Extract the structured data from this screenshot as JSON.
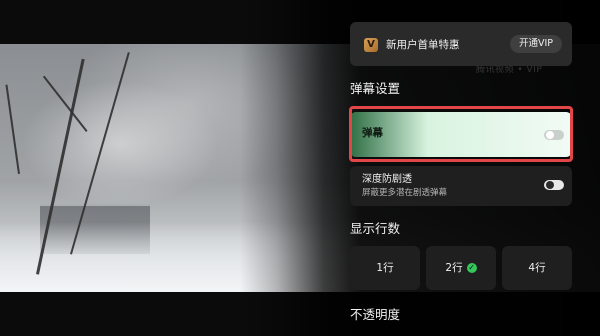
{
  "watermark": "腾讯视频 • VIP",
  "vip": {
    "icon": "V",
    "text": "新用户首单特惠",
    "button": "开通VIP"
  },
  "danmaku": {
    "section_title": "弹幕设置",
    "toggle_label": "弹幕",
    "toggle_state": "off",
    "depth": {
      "title": "深度防剧透",
      "subtitle": "屏蔽更多潜在剧透弹幕",
      "toggle_state": "off"
    }
  },
  "lines": {
    "section_title": "显示行数",
    "options": [
      "1行",
      "2行",
      "4行"
    ],
    "selected": "2行",
    "check_icon": "✓"
  },
  "opacity": {
    "section_title": "不透明度"
  },
  "colors": {
    "highlight": "#e24648",
    "check": "#34c759"
  }
}
